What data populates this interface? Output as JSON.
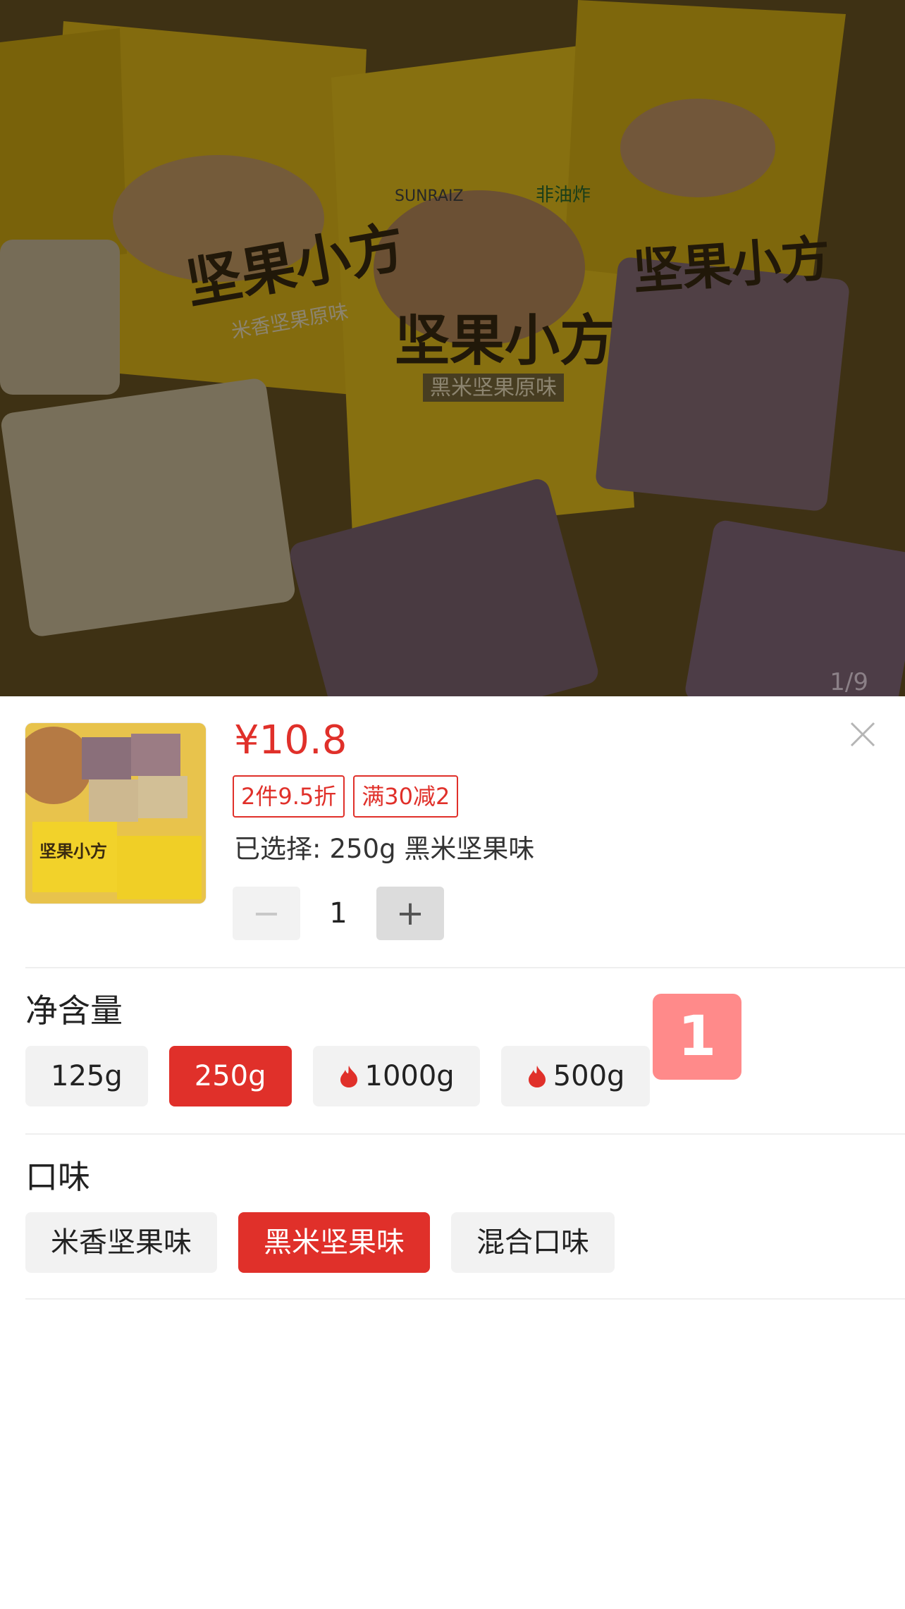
{
  "hero": {
    "page_indicator": "1/9",
    "bag_text_main": "坚果小方",
    "bag_text_flavor_left": "米香坚果原味",
    "bag_text_flavor_center": "黑米坚果原味",
    "bag_brand": "SUNRAIZ",
    "bag_tag": "非油炸"
  },
  "product": {
    "price": "¥10.8",
    "promotions": [
      "2件9.5折",
      "满30减2"
    ],
    "selected_prefix": "已选择:",
    "selected_value": "250g 黑米坚果味",
    "quantity": "1",
    "minus_label": "−",
    "plus_label": "+"
  },
  "net_content": {
    "title": "净含量",
    "options": [
      {
        "label": "125g",
        "active": false,
        "hot": false
      },
      {
        "label": "250g",
        "active": true,
        "hot": false
      },
      {
        "label": "1000g",
        "active": false,
        "hot": true
      },
      {
        "label": "500g",
        "active": false,
        "hot": true
      }
    ]
  },
  "flavor": {
    "title": "口味",
    "options": [
      {
        "label": "米香坚果味",
        "active": false
      },
      {
        "label": "黑米坚果味",
        "active": true
      },
      {
        "label": "混合口味",
        "active": false
      }
    ]
  },
  "badge": "1",
  "colors": {
    "accent": "#e0302a",
    "chip_bg": "#f2f2f2",
    "badge": "#ff8a8a"
  }
}
